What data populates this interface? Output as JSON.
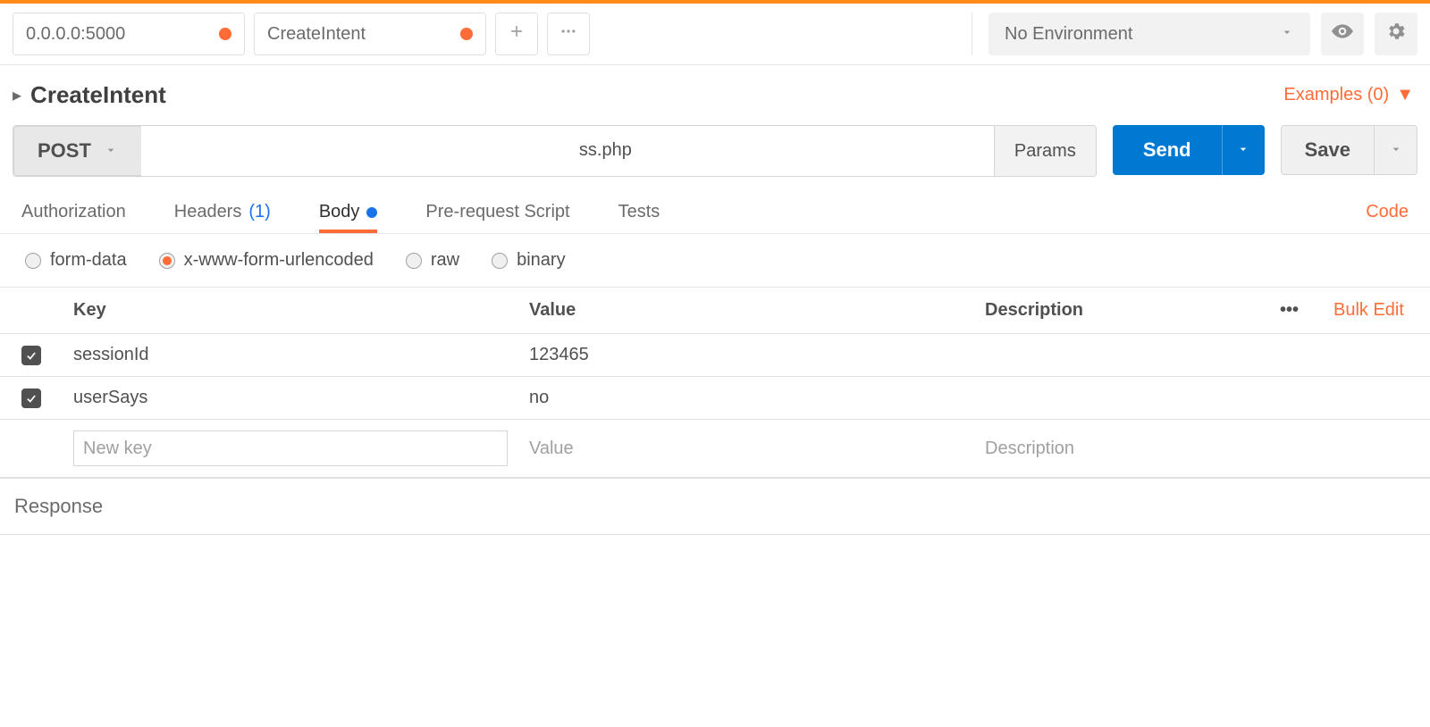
{
  "tabs": [
    {
      "label": "0.0.0.0:5000",
      "dirty": true
    },
    {
      "label": "CreateIntent",
      "dirty": true
    }
  ],
  "environment": {
    "label": "No Environment"
  },
  "request_title": "CreateIntent",
  "examples": {
    "label": "Examples (0)"
  },
  "method": "POST",
  "url_visible_suffix": "ss.php",
  "params_label": "Params",
  "send_label": "Send",
  "save_label": "Save",
  "subtabs": {
    "authorization": "Authorization",
    "headers": "Headers",
    "headers_count": "(1)",
    "body": "Body",
    "prerequest": "Pre-request Script",
    "tests": "Tests"
  },
  "code_link": "Code",
  "body_types": {
    "form_data": "form-data",
    "urlencoded": "x-www-form-urlencoded",
    "raw": "raw",
    "binary": "binary"
  },
  "table": {
    "headers": {
      "key": "Key",
      "value": "Value",
      "description": "Description"
    },
    "bulk_edit": "Bulk Edit",
    "rows": [
      {
        "key": "sessionId",
        "value": "123465",
        "description": ""
      },
      {
        "key": "userSays",
        "value": "no",
        "description": ""
      }
    ],
    "placeholders": {
      "key": "New key",
      "value": "Value",
      "description": "Description"
    }
  },
  "response_label": "Response"
}
